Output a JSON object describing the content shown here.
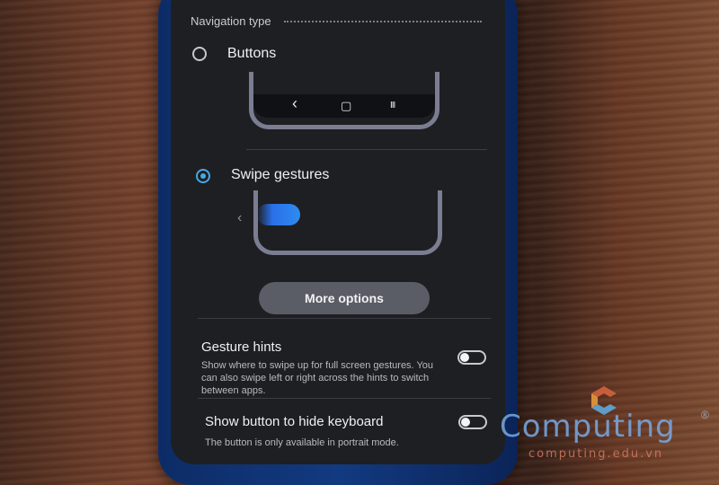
{
  "navigation": {
    "section_title": "Navigation type",
    "options": [
      {
        "label": "Buttons",
        "selected": false
      },
      {
        "label": "Swipe gestures",
        "selected": true
      }
    ],
    "buttons_preview_icons": [
      "back-icon",
      "home-icon",
      "recents-icon"
    ],
    "nav_glyphs": {
      "back": "‹",
      "home": "▢",
      "recents": "III"
    },
    "swipe_preview_arrow": "‹",
    "more_options_label": "More options"
  },
  "settings": {
    "gesture_hints": {
      "title": "Gesture hints",
      "description": "Show where to swipe up for full screen gestures. You can also swipe left or right across the hints to switch between apps.",
      "enabled": false
    },
    "hide_keyboard_button": {
      "title": "Show button to hide keyboard",
      "description": "The button is only available in portrait mode.",
      "enabled": false
    }
  },
  "watermark": {
    "brand": "Computing",
    "registered": "®",
    "url": "computing.edu.vn"
  },
  "colors": {
    "accent": "#47a8e6",
    "screen_bg": "#1e1f22",
    "button_bg": "#5b5d66"
  }
}
